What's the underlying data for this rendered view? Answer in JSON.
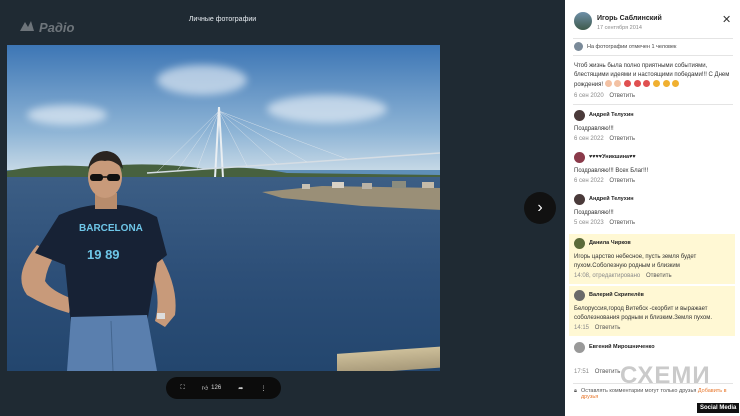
{
  "viewer": {
    "title": "Личные фотографии",
    "watermark": "Радіо",
    "next_icon": "chevron-right-icon",
    "toolbar": {
      "fullscreen_icon": "expand-icon",
      "like_count": "126",
      "share_icon": "share-icon",
      "menu_icon": "more-icon"
    },
    "photo_shirt_text": "BARCELONA",
    "photo_shirt_number": "19 89"
  },
  "panel": {
    "author": "Игорь Саблинский",
    "date": "17 сентября 2014",
    "tag_text": "На фотографии отмечен 1 человек",
    "description": "Чтоб жизнь была полно приятными событиями, блестящими идеями и настоящими победами!!! С Днем рождения!",
    "desc_meta_date": "6 сен 2020",
    "reply_label": "Ответить",
    "comments": [
      {
        "name": "Андрей Телухин",
        "text": "Поздравляю!!!",
        "date": "6 сен 2022",
        "reply": "Ответить"
      },
      {
        "name": "♥♥♥♥Уникшина♥♥",
        "text": "Поздравляю!!! Всех Благ!!!",
        "date": "6 сен 2022",
        "reply": "Ответить"
      },
      {
        "name": "Андрей Телухин",
        "text": "Поздравляю!!!",
        "date": "5 сен 2023",
        "reply": "Ответить"
      },
      {
        "name": "Данила Чирков",
        "text": "Игорь царство небесное, пусть земля будет пухом.Соболезную родным и близким",
        "date": "14:08, отредактировано",
        "reply": "Ответить"
      },
      {
        "name": "Валерий Скрипелёв",
        "text": "Белоруссия,город Витебск -скорбит и выражает соболезнования родным и близким.Земля пухом.",
        "date": "14:15",
        "reply": "Ответить"
      },
      {
        "name": "Евгений Мирошниченко",
        "text": "",
        "date": "17:51",
        "reply": "Ответить"
      }
    ],
    "compose_text": "Оставлять комментарии могут только друзья",
    "compose_link": "Добавить в друзья",
    "schemy_watermark": "СХЕМИ",
    "social_badge": "Social Media"
  },
  "colors": {
    "viewer_bg": "#1f2a33",
    "highlight": "#fff8d4",
    "link_orange": "#e8772c"
  }
}
